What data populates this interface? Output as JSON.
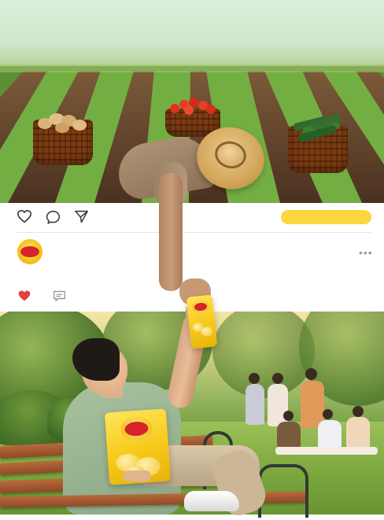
{
  "post": {
    "actions": {
      "like_icon": "heart-outline-icon",
      "comment_icon": "comment-bubble-icon",
      "share_icon": "send-icon"
    },
    "author": {
      "avatar_icon": "lays-logo-icon"
    },
    "menu_icon": "more-dots-icon",
    "menu_glyph": "•••",
    "engagement": {
      "like_icon": "heart-filled-icon",
      "comment_icon": "comment-box-icon"
    }
  },
  "colors": {
    "accent_yellow": "#fdd63e",
    "like_red": "#e5413b",
    "brand_red": "#d8232a",
    "icon_gray": "#3c3c3c"
  }
}
